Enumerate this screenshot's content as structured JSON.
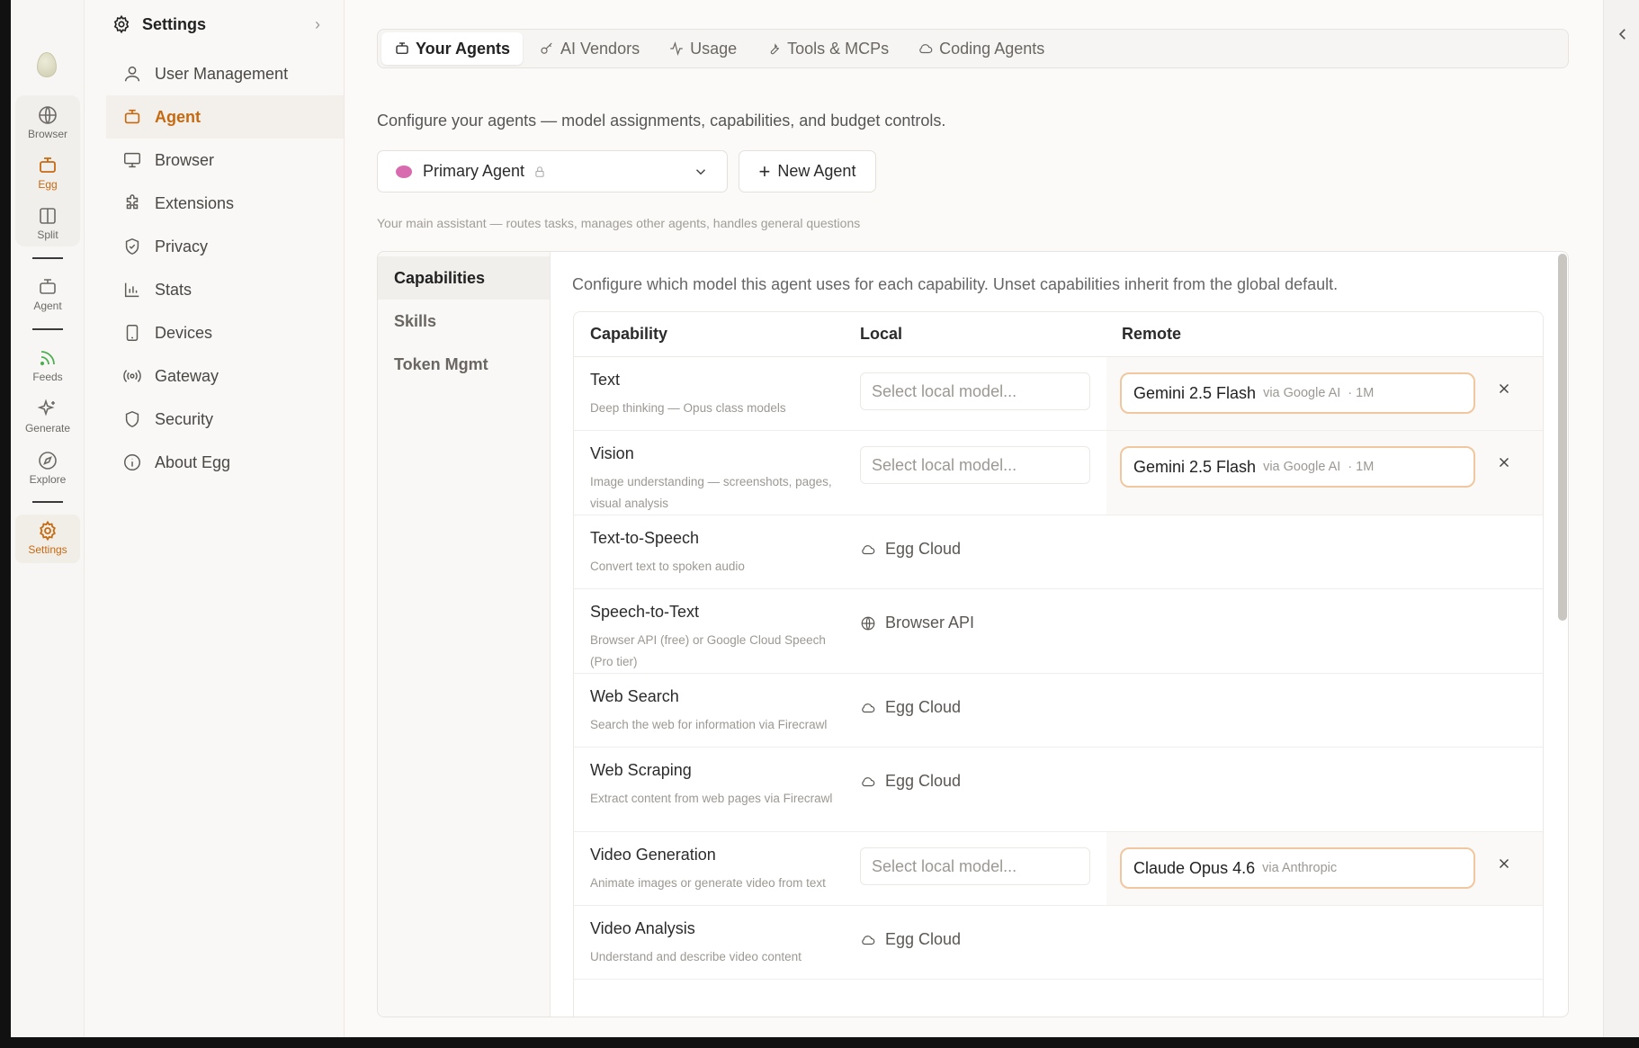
{
  "rail": {
    "items": [
      {
        "label": "Browser",
        "icon": "globe-icon"
      },
      {
        "label": "Egg",
        "icon": "robot-icon",
        "active": true
      },
      {
        "label": "Split",
        "icon": "split-icon"
      },
      {
        "label": "Agent",
        "icon": "robot-icon"
      },
      {
        "label": "Feeds",
        "icon": "rss-icon"
      },
      {
        "label": "Generate",
        "icon": "sparkle-icon"
      },
      {
        "label": "Explore",
        "icon": "compass-icon"
      },
      {
        "label": "Settings",
        "icon": "gear-icon",
        "active": true
      }
    ]
  },
  "sidebar": {
    "title": "Settings",
    "items": [
      {
        "label": "User Management",
        "icon": "user-icon"
      },
      {
        "label": "Agent",
        "icon": "robot-icon",
        "active": true
      },
      {
        "label": "Browser",
        "icon": "monitor-icon"
      },
      {
        "label": "Extensions",
        "icon": "puzzle-icon"
      },
      {
        "label": "Privacy",
        "icon": "shield-check-icon"
      },
      {
        "label": "Stats",
        "icon": "bar-chart-icon"
      },
      {
        "label": "Devices",
        "icon": "tablet-icon"
      },
      {
        "label": "Gateway",
        "icon": "broadcast-icon"
      },
      {
        "label": "Security",
        "icon": "shield-icon"
      },
      {
        "label": "About Egg",
        "icon": "info-icon"
      }
    ]
  },
  "tabs": [
    {
      "label": "Your Agents",
      "icon": "robot-icon",
      "active": true
    },
    {
      "label": "AI Vendors",
      "icon": "key-icon"
    },
    {
      "label": "Usage",
      "icon": "activity-icon"
    },
    {
      "label": "Tools & MCPs",
      "icon": "wrench-icon"
    },
    {
      "label": "Coding Agents",
      "icon": "cloud-icon"
    }
  ],
  "main": {
    "description": "Configure your agents — model assignments, capabilities, and budget controls.",
    "agent_select": {
      "value": "Primary Agent"
    },
    "new_agent_label": "New Agent",
    "agent_subtitle": "Your main assistant — routes tasks, manages other agents, handles general questions"
  },
  "subnav": [
    "Capabilities",
    "Skills",
    "Token Mgmt"
  ],
  "capabilities": {
    "description": "Configure which model this agent uses for each capability. Unset capabilities inherit from the global default.",
    "headers": {
      "capability": "Capability",
      "local": "Local",
      "remote": "Remote"
    },
    "local_placeholder": "Select local model...",
    "rows": [
      {
        "name": "Text",
        "sub": "Deep thinking — Opus class models",
        "remote": {
          "model": "Gemini 2.5 Flash",
          "via": "via Google AI",
          "ctx": "· 1M"
        }
      },
      {
        "name": "Vision",
        "sub": "Image understanding — screenshots, pages, visual analysis",
        "remote": {
          "model": "Gemini 2.5 Flash",
          "via": "via Google AI",
          "ctx": "· 1M"
        }
      },
      {
        "name": "Text-to-Speech",
        "sub": "Convert text to spoken audio",
        "provider": "Egg Cloud",
        "provider_icon": "cloud-icon"
      },
      {
        "name": "Speech-to-Text",
        "sub": "Browser API (free) or Google Cloud Speech (Pro tier)",
        "provider": "Browser API",
        "provider_icon": "globe-icon"
      },
      {
        "name": "Web Search",
        "sub": "Search the web for information via Firecrawl",
        "provider": "Egg Cloud",
        "provider_icon": "cloud-icon"
      },
      {
        "name": "Web Scraping",
        "sub": "Extract content from web pages via Firecrawl",
        "provider": "Egg Cloud",
        "provider_icon": "cloud-icon"
      },
      {
        "name": "Video Generation",
        "sub": "Animate images or generate video from text",
        "remote": {
          "model": "Claude Opus 4.6",
          "via": "via Anthropic",
          "ctx": ""
        }
      },
      {
        "name": "Video Analysis",
        "sub": "Understand and describe video content",
        "provider": "Egg Cloud",
        "provider_icon": "cloud-icon"
      }
    ]
  },
  "colors": {
    "accent": "#c66a12",
    "remote_border": "#f0c79f"
  }
}
